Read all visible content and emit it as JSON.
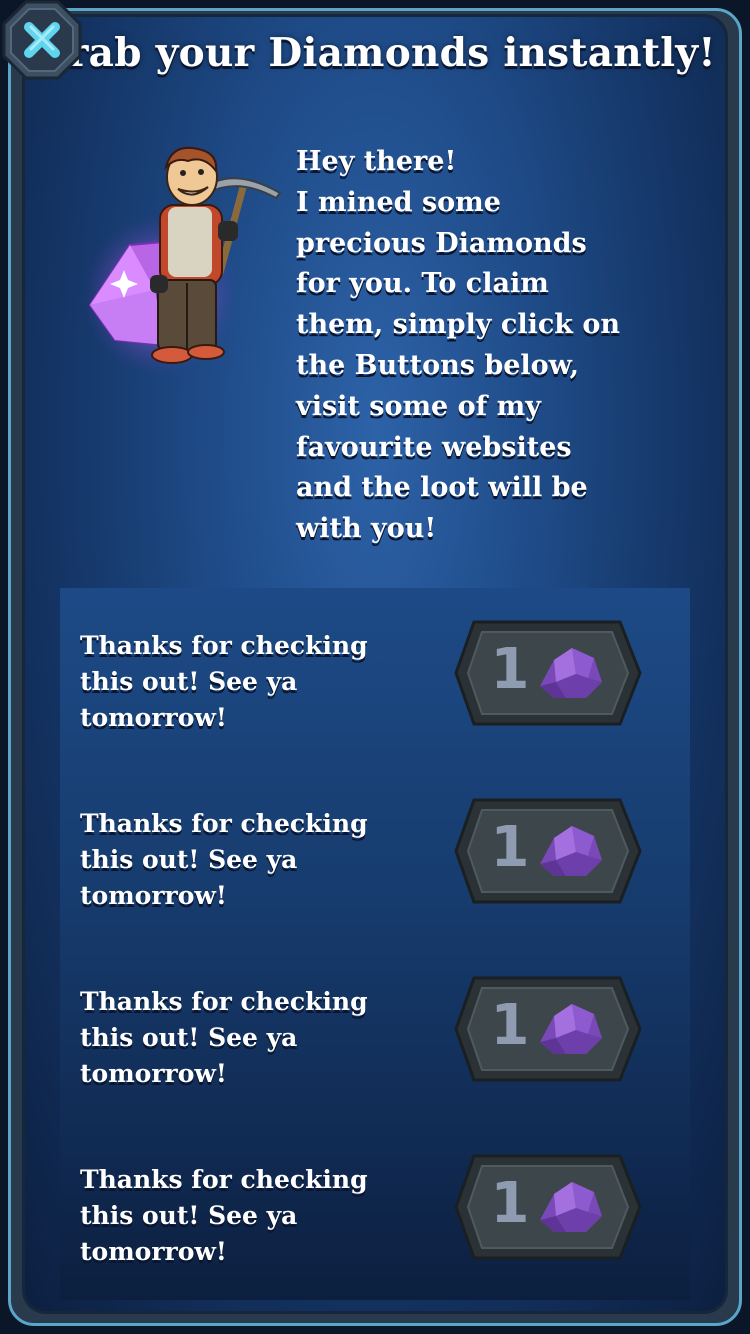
{
  "dialog": {
    "title": "Grab your Diamonds instantly!",
    "close_icon": "close-x-icon"
  },
  "intro": {
    "character": "miner-with-pickaxe",
    "lines": [
      "Hey there!",
      "I mined some",
      "precious Diamonds",
      "for you. To claim",
      "them, simply click on",
      "the Buttons below,",
      "visit some of my",
      "favourite websites",
      "and the loot will be",
      "with you!"
    ]
  },
  "offers": [
    {
      "lines": [
        "Thanks for checking",
        "this out! See ya",
        "tomorrow!"
      ],
      "reward": "1",
      "reward_icon": "diamond-icon"
    },
    {
      "lines": [
        "Thanks for checking",
        "this out! See ya",
        "tomorrow!"
      ],
      "reward": "1",
      "reward_icon": "diamond-icon"
    },
    {
      "lines": [
        "Thanks for checking",
        "this out! See ya",
        "tomorrow!"
      ],
      "reward": "1",
      "reward_icon": "diamond-icon"
    },
    {
      "lines": [
        "Thanks for checking",
        "this out! See ya",
        "tomorrow!"
      ],
      "reward": "1",
      "reward_icon": "diamond-icon"
    }
  ],
  "colors": {
    "panel": "#1e4a86",
    "frame_border": "#5aa6c8",
    "diamond": "#9b5fd4",
    "button_disabled": "#3a4247"
  }
}
